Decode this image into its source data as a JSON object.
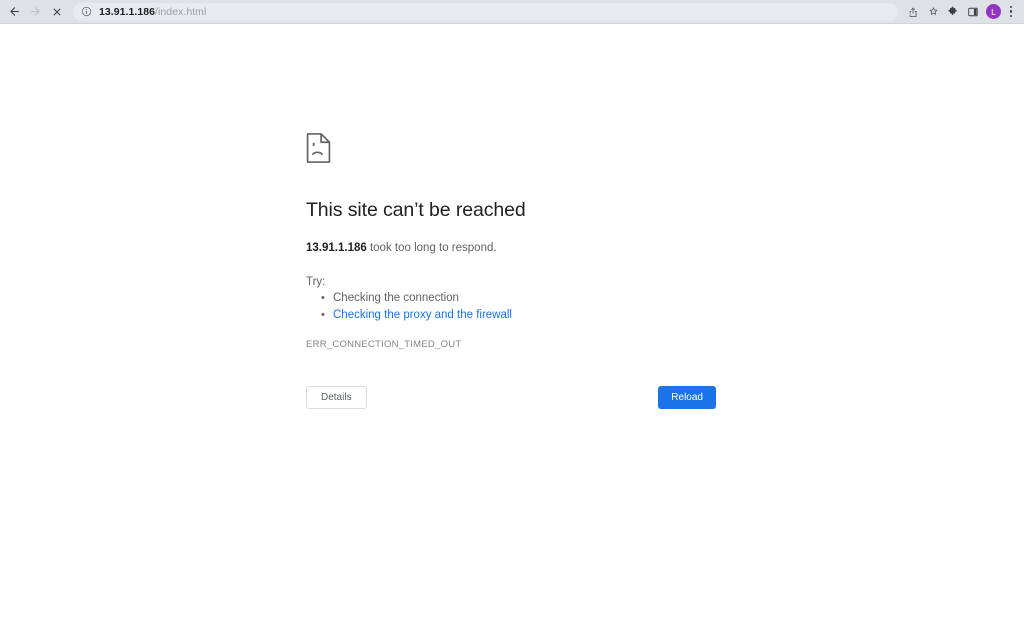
{
  "browser": {
    "nav": {
      "back_label": "Back",
      "forward_label": "Forward",
      "stop_label": "Stop loading"
    },
    "omnibox": {
      "info_icon": "info-circle-icon",
      "host": "13.91.1.186",
      "path": "/index.html",
      "full_url": "13.91.1.186/index.html"
    },
    "actions": [
      {
        "name": "share-icon",
        "label": "Share"
      },
      {
        "name": "bookmark-star-icon",
        "label": "Bookmark this tab"
      },
      {
        "name": "extensions-puzzle-icon",
        "label": "Extensions"
      },
      {
        "name": "side-panel-icon",
        "label": "Side panel"
      }
    ],
    "profile": {
      "initial": "L",
      "color": "#9334c3"
    },
    "menu": {
      "name": "three-dot-menu-icon",
      "label": "Customize and control Google Chrome"
    }
  },
  "error_page": {
    "icon": "sad-page-icon",
    "title": "This site can’t be reached",
    "subtitle": {
      "host": "13.91.1.186",
      "rest": " took too long to respond."
    },
    "try_label": "Try:",
    "suggestions": [
      {
        "text": "Checking the connection",
        "is_link": false
      },
      {
        "text": "Checking the proxy and the firewall",
        "is_link": true
      }
    ],
    "error_code": "ERR_CONNECTION_TIMED_OUT",
    "buttons": {
      "details": "Details",
      "reload": "Reload"
    }
  },
  "colors": {
    "toolbar_bg": "#dee1e6",
    "omnibox_bg": "#e8eaed",
    "link_blue": "#1a73e8",
    "reload_blue": "#1a73e8",
    "text_primary": "#202124",
    "text_secondary": "#5f6368"
  }
}
